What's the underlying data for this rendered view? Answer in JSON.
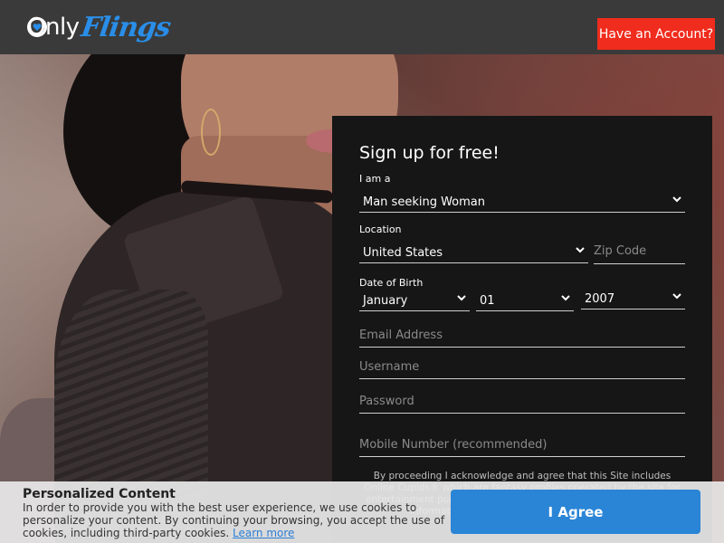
{
  "header": {
    "logo_only": "Only",
    "logo_flings": "Flings",
    "account_button": "Have an Account?"
  },
  "form": {
    "title": "Sign up for free!",
    "iam_label": "I am a",
    "iam_value": "Man seeking Woman",
    "location_label": "Location",
    "country_value": "United States",
    "zip_placeholder": "Zip Code",
    "dob_label": "Date of Birth",
    "dob_month": "January",
    "dob_day": "01",
    "dob_year": "2007",
    "email_placeholder": "Email Address",
    "username_placeholder": "Username",
    "password_placeholder": "Password",
    "mobile_placeholder": "Mobile Number (recommended)",
    "disclaimer": "By proceeding I acknowledge and agree that this Site includes Online Cupids® which are fantasy profiles operated by the site for entertainment purposes, which may interact with users. For more information regarding Online Cupids click here."
  },
  "cookie": {
    "title": "Personalized Content",
    "text": "In order to provide you with the best user experience, we use cookies to personalize your content. By continuing your browsing, you accept the use of cookies, including third-party cookies.",
    "link": "Learn more",
    "agree_button": "I Agree"
  },
  "colors": {
    "header_bg": "#3a3a3a",
    "account_button_bg": "#ef2c1d",
    "form_bg": "#161616",
    "agree_button_bg": "#2a85d6",
    "brand_blue": "#2a8ee8"
  }
}
